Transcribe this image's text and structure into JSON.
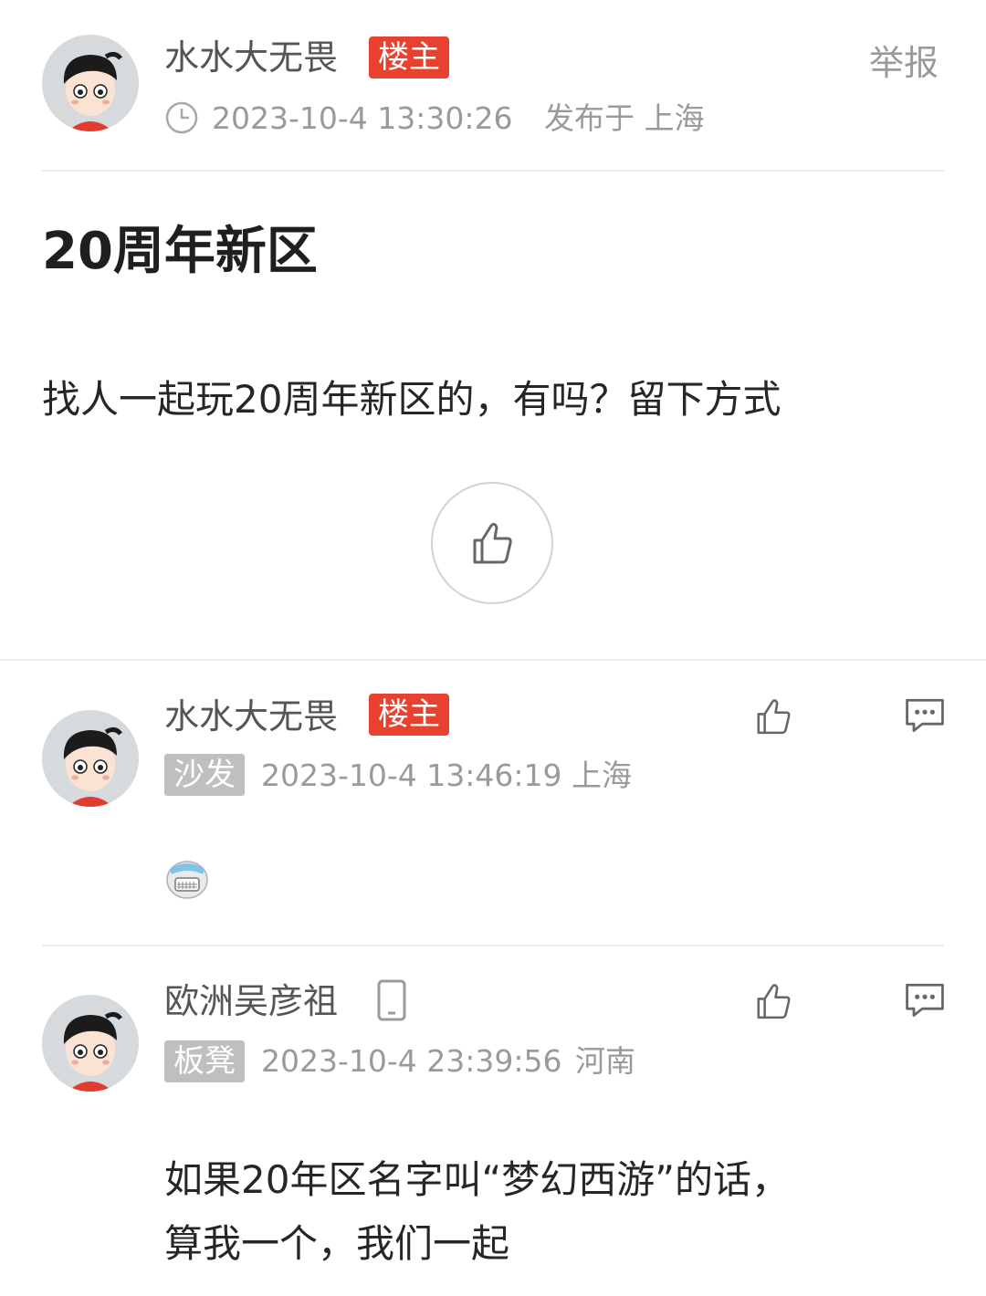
{
  "post": {
    "author": "水水大无畏",
    "owner_badge": "楼主",
    "report_label": "举报",
    "time": "2023-10-4 13:30:26",
    "published_in": "发布于 上海",
    "title": "20周年新区",
    "content": "找人一起玩20周年新区的，有吗？留下方式"
  },
  "replies": [
    {
      "author": "水水大无畏",
      "owner_badge": "楼主",
      "floor": "沙发",
      "time": "2023-10-4 13:46:19",
      "location": "上海"
    },
    {
      "author": "欧洲吴彦祖",
      "floor": "板凳",
      "time": "2023-10-4 23:39:56",
      "location": "河南",
      "content_line1": "如果20年区名字叫“梦幻西游”的话，",
      "content_line2": "算我一个，我们一起"
    }
  ],
  "colors": {
    "accent_red": "#e8412f",
    "floor_badge_gray": "#bfbfbf",
    "meta_gray": "#9a9a9a"
  },
  "icons": [
    "clock-icon",
    "thumbs-up-icon",
    "comment-icon",
    "phone-icon",
    "emoji-sticker-icon"
  ]
}
